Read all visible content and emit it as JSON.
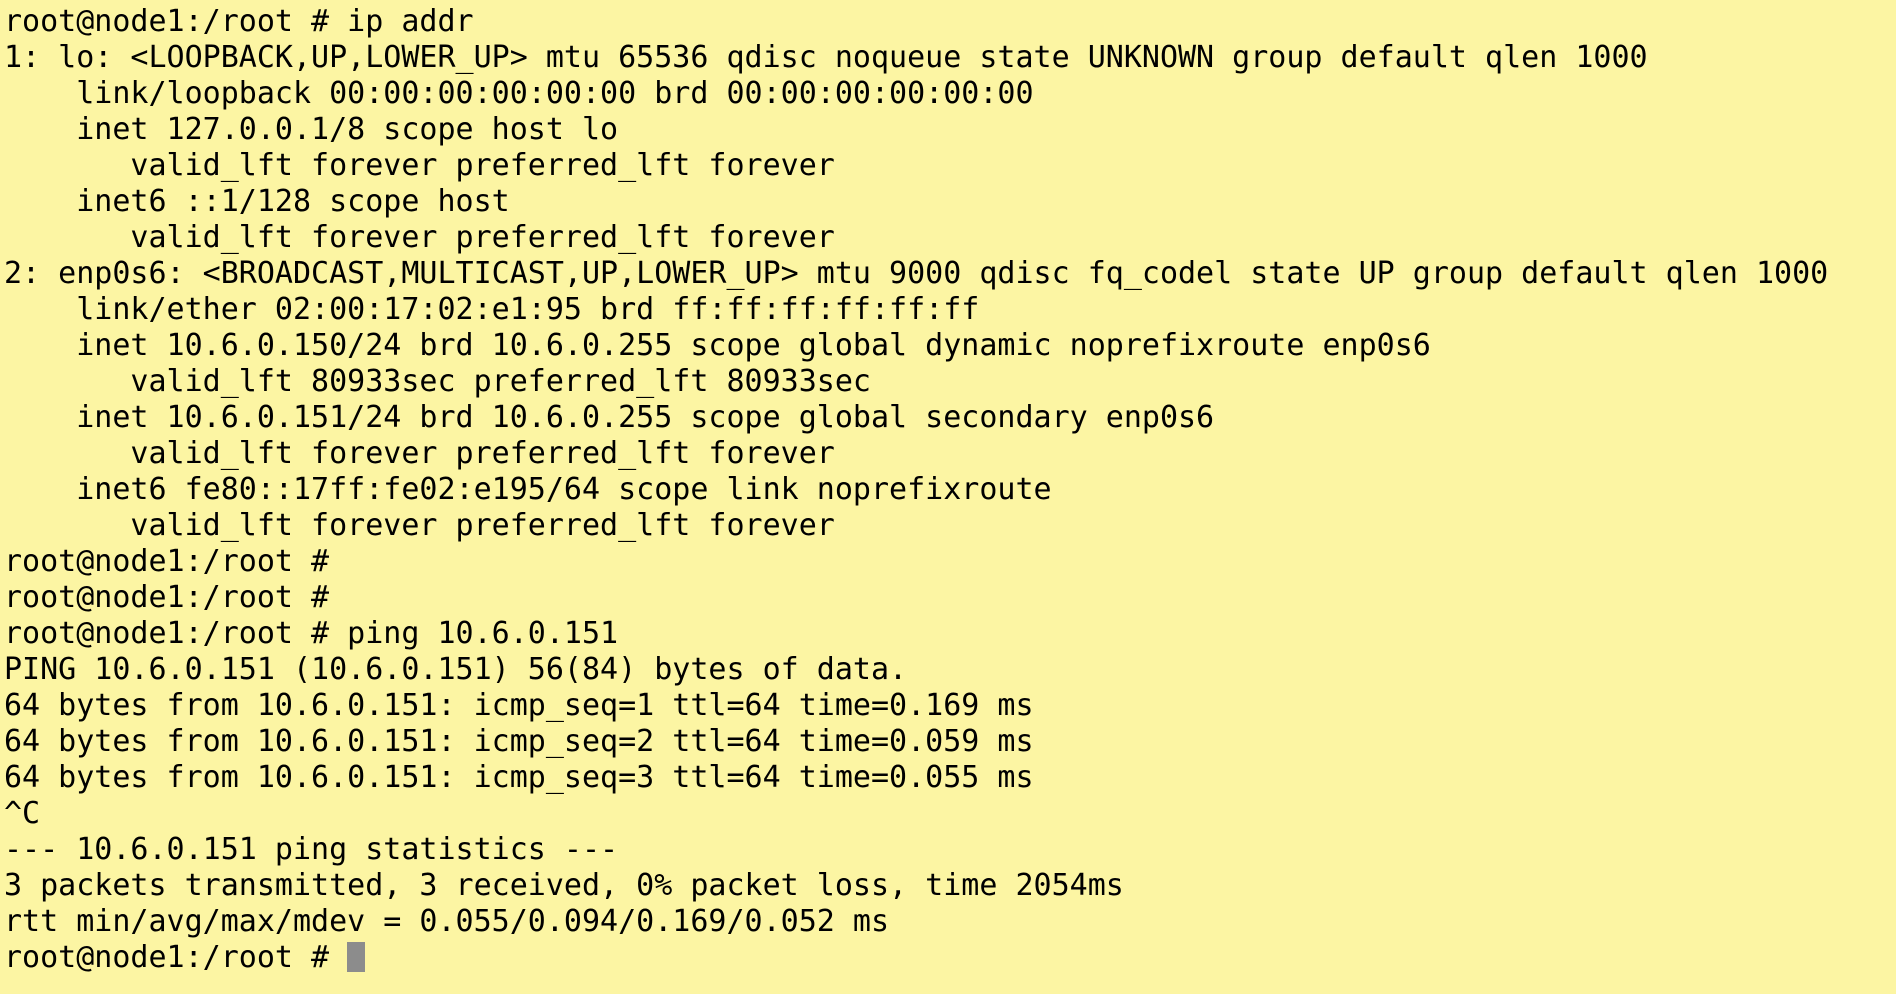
{
  "terminal": {
    "background": "#fcf5a3",
    "foreground": "#000000",
    "cursor_color": "#8c8c8c",
    "lines": [
      "root@node1:/root # ip addr",
      "1: lo: <LOOPBACK,UP,LOWER_UP> mtu 65536 qdisc noqueue state UNKNOWN group default qlen 1000",
      "    link/loopback 00:00:00:00:00:00 brd 00:00:00:00:00:00",
      "    inet 127.0.0.1/8 scope host lo",
      "       valid_lft forever preferred_lft forever",
      "    inet6 ::1/128 scope host",
      "       valid_lft forever preferred_lft forever",
      "2: enp0s6: <BROADCAST,MULTICAST,UP,LOWER_UP> mtu 9000 qdisc fq_codel state UP group default qlen 1000",
      "    link/ether 02:00:17:02:e1:95 brd ff:ff:ff:ff:ff:ff",
      "    inet 10.6.0.150/24 brd 10.6.0.255 scope global dynamic noprefixroute enp0s6",
      "       valid_lft 80933sec preferred_lft 80933sec",
      "    inet 10.6.0.151/24 brd 10.6.0.255 scope global secondary enp0s6",
      "       valid_lft forever preferred_lft forever",
      "    inet6 fe80::17ff:fe02:e195/64 scope link noprefixroute",
      "       valid_lft forever preferred_lft forever",
      "root@node1:/root #",
      "root@node1:/root #",
      "root@node1:/root # ping 10.6.0.151",
      "PING 10.6.0.151 (10.6.0.151) 56(84) bytes of data.",
      "64 bytes from 10.6.0.151: icmp_seq=1 ttl=64 time=0.169 ms",
      "64 bytes from 10.6.0.151: icmp_seq=2 ttl=64 time=0.059 ms",
      "64 bytes from 10.6.0.151: icmp_seq=3 ttl=64 time=0.055 ms",
      "^C",
      "--- 10.6.0.151 ping statistics ---",
      "3 packets transmitted, 3 received, 0% packet loss, time 2054ms",
      "rtt min/avg/max/mdev = 0.055/0.094/0.169/0.052 ms"
    ],
    "prompt": "root@node1:/root # "
  }
}
